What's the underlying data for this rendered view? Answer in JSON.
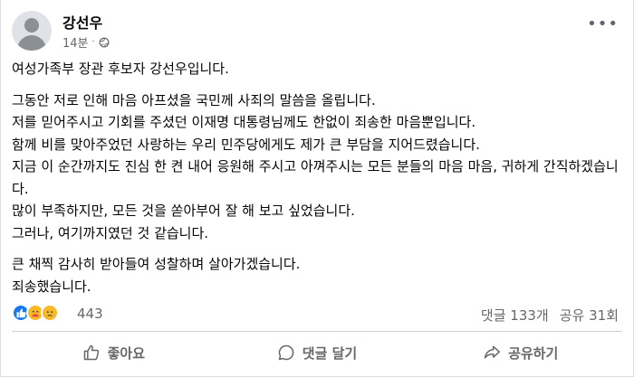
{
  "post": {
    "author": "강선우",
    "time": "14분",
    "separator": "·",
    "privacy_icon": "globe-icon",
    "more_icon": "more-options-icon",
    "paragraphs": [
      [
        "여성가족부 장관 후보자 강선우입니다."
      ],
      [
        "그동안 저로 인해 마음 아프셨을 국민께 사죄의 말씀을 올립니다.",
        "저를 믿어주시고 기회를 주셨던 이재명 대통령님께도 한없이 죄송한 마음뿐입니다.",
        "함께 비를 맞아주었던 사랑하는 우리 민주당에게도 제가 큰 부담을 지어드렸습니다.",
        "지금 이 순간까지도 진심 한 켠 내어 응원해 주시고 아껴주시는 모든 분들의 마음 마음, 귀하게 간직하겠습니다.",
        "많이 부족하지만, 모든 것을 쏟아부어 잘 해 보고 싶었습니다.",
        "그러나, 여기까지였던 것 같습니다."
      ],
      [
        "큰 채찍 감사히 받아들여 성찰하며 살아가겠습니다.",
        "죄송했습니다."
      ]
    ]
  },
  "reactions": {
    "icons": [
      "like-reaction-icon",
      "care-reaction-icon",
      "sad-reaction-icon"
    ],
    "count": "443",
    "comments": "댓글 133개",
    "shares": "공유 31회"
  },
  "actions": {
    "like": "좋아요",
    "comment": "댓글 달기",
    "share": "공유하기"
  },
  "colors": {
    "accent": "#1877f2",
    "muted": "#65676b",
    "divider": "#ced0d4"
  }
}
